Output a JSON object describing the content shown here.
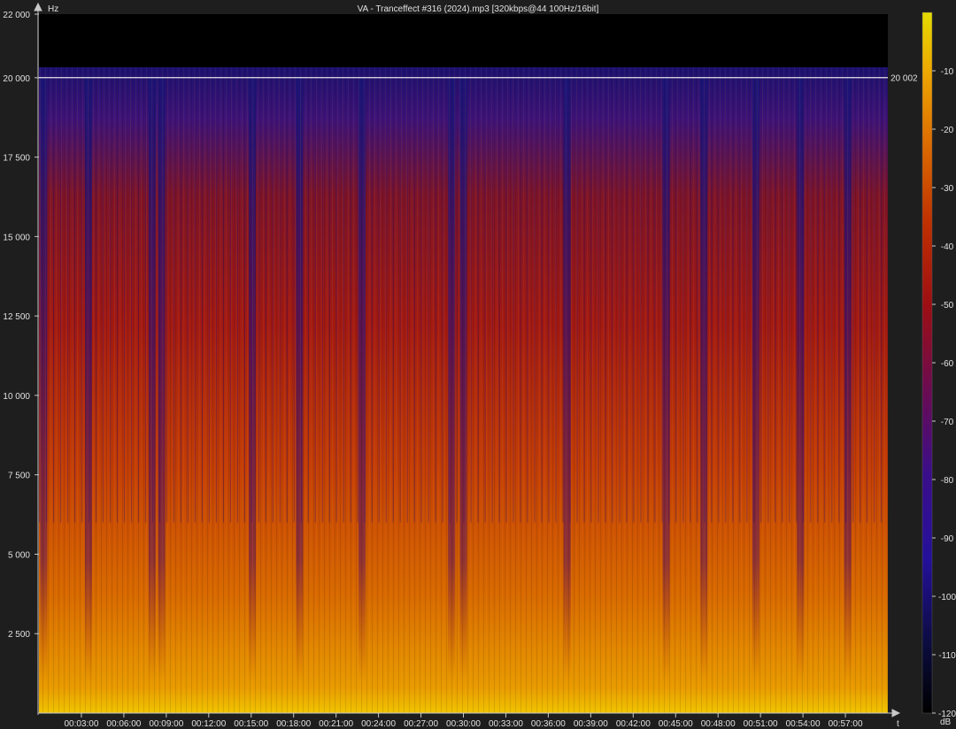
{
  "window": {
    "title": "VA - Tranceffect #316 (2024).mp3 [320kbps@44 100Hz/16bit]"
  },
  "colors": {
    "background": "#1e1e1e",
    "axis": "#c8c8c8",
    "text": "#e0e0e0",
    "cutoff_line": "#e6e6e6",
    "colormap": [
      "#000000",
      "#10104a",
      "#2a0e9e",
      "#5a0c8a",
      "#8a0f36",
      "#b01410",
      "#d03a00",
      "#e87a00",
      "#f5b800",
      "#e8e000"
    ]
  },
  "chart_data": {
    "type": "heatmap",
    "title": "VA - Tranceffect #316 (2024).mp3 [320kbps@44 100Hz/16bit]",
    "xlabel": "t",
    "ylabel": "Hz",
    "ylim": [
      0,
      22000
    ],
    "xlim_seconds": [
      0,
      3600
    ],
    "y_ticks": [
      2500,
      5000,
      7500,
      10000,
      12500,
      15000,
      17500,
      20000,
      22000
    ],
    "y_tick_labels": [
      "2 500",
      "5 000",
      "7 500",
      "10 000",
      "12 500",
      "15 000",
      "17 500",
      "20 000",
      "22 000"
    ],
    "x_ticks_seconds": [
      180,
      360,
      540,
      720,
      900,
      1080,
      1260,
      1440,
      1620,
      1800,
      1980,
      2160,
      2340,
      2520,
      2700,
      2880,
      3060,
      3240,
      3420
    ],
    "x_tick_labels": [
      "00:03:00",
      "00:06:00",
      "00:09:00",
      "00:12:00",
      "00:15:00",
      "00:18:00",
      "00:21:00",
      "00:24:00",
      "00:27:00",
      "00:30:00",
      "00:33:00",
      "00:36:00",
      "00:39:00",
      "00:42:00",
      "00:45:00",
      "00:48:00",
      "00:51:00",
      "00:54:00",
      "00:57:00"
    ],
    "cutoff_frequency_hz": 20002,
    "cutoff_label": "20 002",
    "colorbar": {
      "label": "dB",
      "range": [
        -120,
        0
      ],
      "ticks": [
        -10,
        -20,
        -30,
        -40,
        -50,
        -60,
        -70,
        -80,
        -90,
        -100,
        -110,
        -120
      ],
      "tick_labels": [
        "-10",
        "-20",
        "-30",
        "-40",
        "-50",
        "-60",
        "-70",
        "-80",
        "-90",
        "-100",
        "-110",
        "-120"
      ]
    },
    "quiet_bands_seconds": [
      20,
      210,
      480,
      520,
      905,
      1105,
      1370,
      1750,
      1800,
      2240,
      2660,
      2820,
      3040,
      3230,
      3430
    ]
  }
}
